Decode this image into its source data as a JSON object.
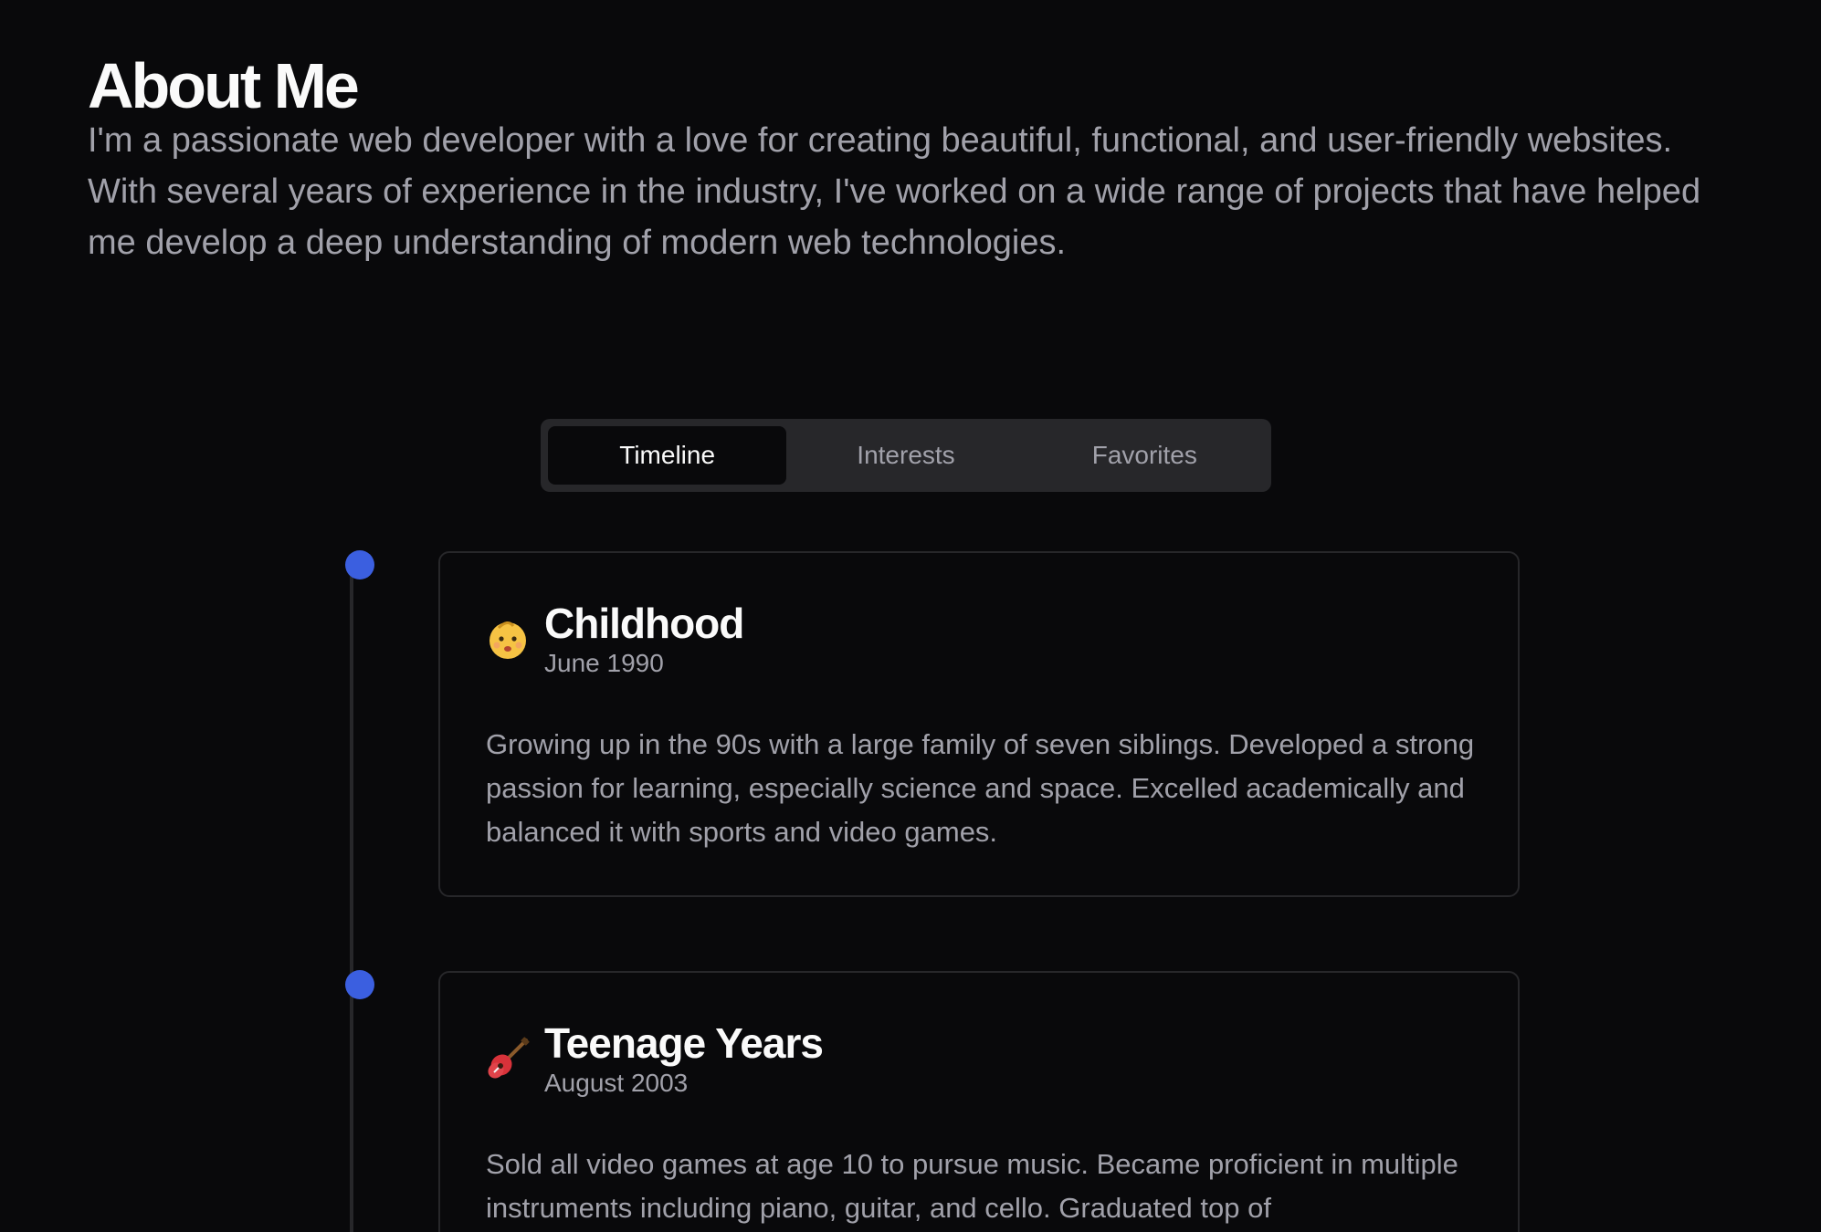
{
  "header": {
    "title": "About Me",
    "intro": "I'm a passionate web developer with a love for creating beautiful, functional, and user-friendly websites. With several years of experience in the industry, I've worked on a wide range of projects that have helped me develop a deep understanding of modern web technologies."
  },
  "tabs": [
    {
      "label": "Timeline",
      "active": true
    },
    {
      "label": "Interests",
      "active": false
    },
    {
      "label": "Favorites",
      "active": false
    }
  ],
  "timeline": [
    {
      "icon": "baby-emoji-icon",
      "title": "Childhood",
      "date": "June 1990",
      "text": "Growing up in the 90s with a large family of seven siblings. Developed a strong passion for learning, especially science and space. Excelled academically and balanced it with sports and video games."
    },
    {
      "icon": "guitar-emoji-icon",
      "title": "Teenage Years",
      "date": "August 2003",
      "text": "Sold all video games at age 10 to pursue music. Became proficient in multiple instruments including piano, guitar, and cello. Graduated top of"
    }
  ],
  "colors": {
    "background": "#09090b",
    "accent": "#3b5fe0",
    "muted_text": "#a1a1aa",
    "border": "#27272a"
  }
}
